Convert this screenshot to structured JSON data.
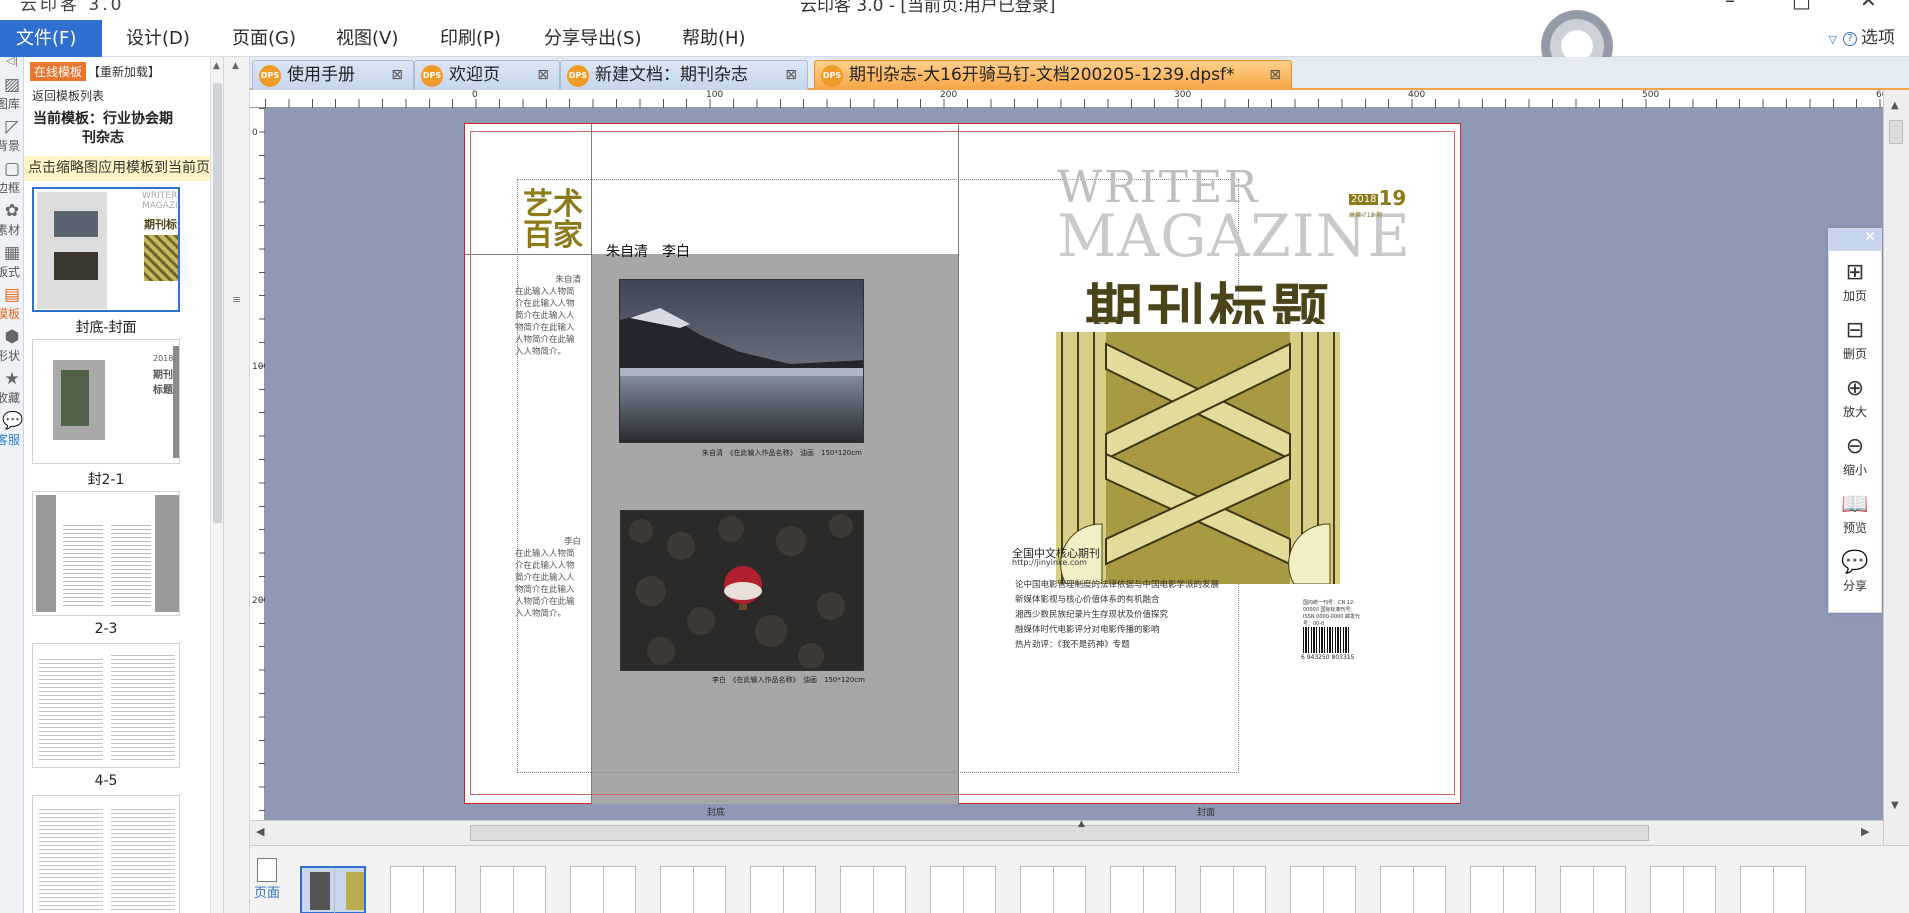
{
  "window": {
    "title": "云印客 3.0 - [当前页:用户已登录]",
    "logo": "云印客 3.0"
  },
  "menu": {
    "items": [
      "文件(F)",
      "设计(D)",
      "页面(G)",
      "视图(V)",
      "印刷(P)",
      "分享导出(S)",
      "帮助(H)"
    ],
    "options": "选项"
  },
  "tools": [
    "图库",
    "背景",
    "边框",
    "素材",
    "板式",
    "模板",
    "形状",
    "收藏",
    "客服"
  ],
  "template_panel": {
    "tab_online": "在线模板",
    "tab_reload": "【重新加载】",
    "back": "返回模板列表",
    "current": "当前模板：行业协会期刊杂志",
    "hint": "点击缩略图应用模板到当前页",
    "thumbs": [
      "封底-封面",
      "封2-1",
      "2-3",
      "4-5",
      ""
    ]
  },
  "doc_tabs": [
    "使用手册",
    "欢迎页",
    "新建文档：期刊杂志",
    "期刊杂志-大16开骑马钉-文档200205-1239.dpsf*"
  ],
  "ruler": {
    "h": [
      "0",
      "100",
      "200",
      "300",
      "400",
      "500",
      "600"
    ],
    "v": [
      "0",
      "100",
      "200"
    ]
  },
  "page": {
    "left_title": "艺术百家",
    "names": "朱自清　李白",
    "bio1_name": "朱自清",
    "bio1": "在此输入人物简介在此输入人物简介在此输入人物简介在此输入人物简介在此输入人物简介。",
    "caption1": "朱自清　《在此输入作品名称》　油画　150*120cm",
    "bio2_name": "李白",
    "bio2": "在此输入人物简介在此输入人物简介在此输入人物简介在此输入人物简介在此输入人物简介。",
    "caption2": "李白　《在此输入作品名称》　油画　150*120cm",
    "writer": "WRITER",
    "magazine": "MAGAZINE",
    "year": "2018",
    "issue_no": "19",
    "issue_total": "总第 712 期",
    "mag_title": "期刊标题",
    "core": "全国中文核心期刊",
    "url": "http://jinyinke.com",
    "toc": [
      "论中国电影管理制度的法律依据与中国电影学派的发展",
      "新媒体影视与核心价值体系的有机融合",
      "湘西少数民族纪录片生存现状及价值探究",
      "融媒体时代电影评分对电影传播的影响",
      "热片劲评：《我不是药神》专题"
    ],
    "isbn": "国内统一刊号：CN 12-0000/I 国际标准刊号：ISSN 0000-0000 邮发代号：00-0",
    "barcode_num": "6 943250 803315",
    "back_label": "封底",
    "front_label": "封面"
  },
  "float_toolbar": [
    "加页",
    "删页",
    "放大",
    "缩小",
    "预览",
    "分享"
  ],
  "page_strip": {
    "label": "页面",
    "count": 17
  }
}
